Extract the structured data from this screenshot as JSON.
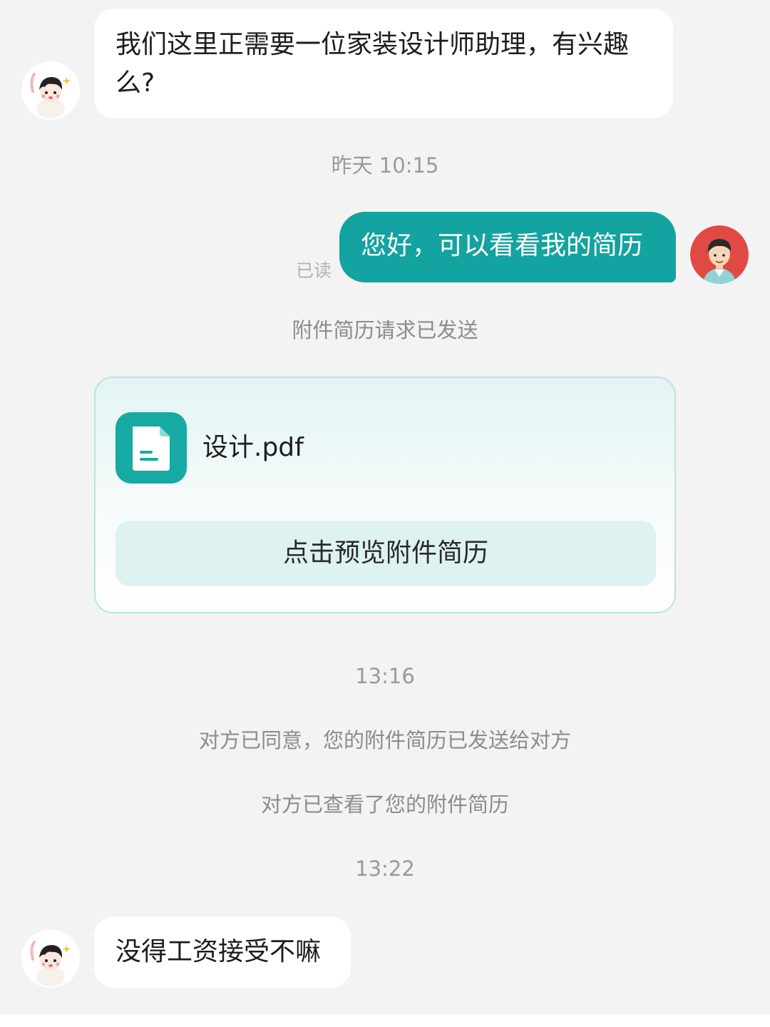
{
  "messages": {
    "m1": {
      "text": "我们这里正需要一位家装设计师助理，有兴趣么?"
    },
    "t1": "昨天 10:15",
    "m2": {
      "text": "您好，可以看看我的简历",
      "read_status": "已读"
    },
    "sys1": "附件简历请求已发送",
    "file": {
      "name": "设计.pdf",
      "preview_label": "点击预览附件简历",
      "icon": "document-icon"
    },
    "t2": "13:16",
    "sys2": "对方已同意，您的附件简历已发送给对方",
    "sys3": "对方已查看了您的附件简历",
    "t3": "13:22",
    "m3": {
      "text": "没得工资接受不嘛"
    }
  },
  "colors": {
    "outgoing_bubble": "#13a3a0",
    "incoming_bubble": "#ffffff",
    "background": "#f3f3f3",
    "file_icon": "#17a9a4",
    "preview_button": "#def2f2"
  }
}
